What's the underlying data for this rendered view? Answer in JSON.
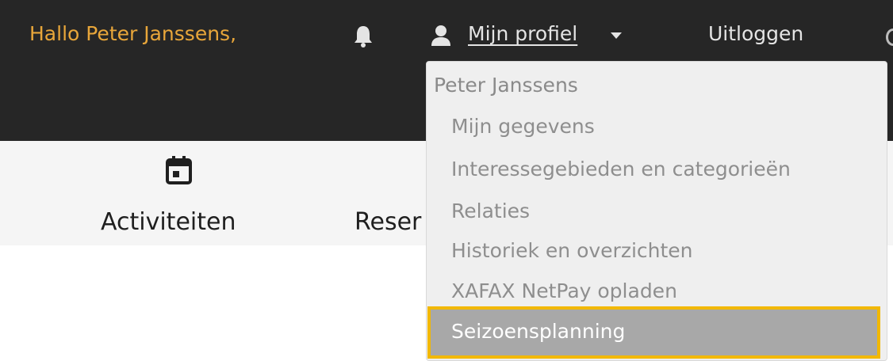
{
  "header": {
    "greeting": "Hallo Peter Janssens,",
    "profile_label": "Mijn profiel",
    "logout_label": "Uitloggen"
  },
  "nav": {
    "activiteiten_label": "Activiteiten",
    "reservaties_label_partial": "Reser"
  },
  "dropdown": {
    "user_name": "Peter Janssens",
    "items": [
      "Mijn gegevens",
      "Interessegebieden en categorieën",
      "Relaties",
      "Historiek en overzichten",
      "XAFAX NetPay opladen"
    ],
    "active_item": "Seizoensplanning"
  },
  "icons": {
    "bell": "bell-icon",
    "user": "user-icon",
    "caret": "caret-down-icon",
    "calendar": "calendar-icon"
  },
  "colors": {
    "topbar_bg": "#262626",
    "greeting": "#e8a63a",
    "highlight_border": "#f2b800",
    "active_bg": "#a8a8a8"
  }
}
